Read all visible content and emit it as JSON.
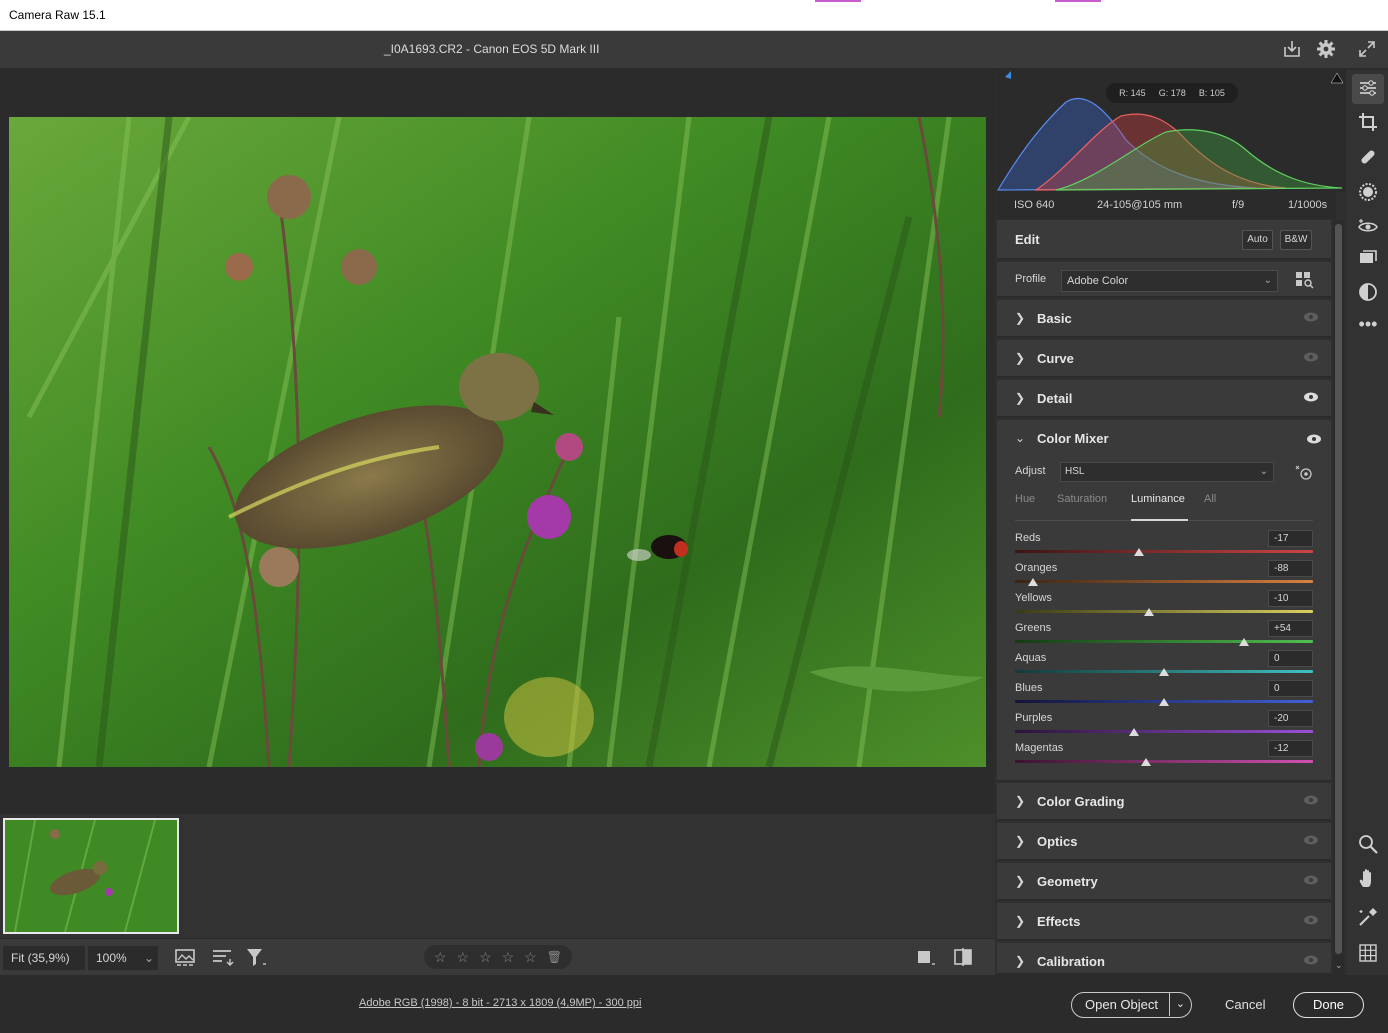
{
  "window": {
    "title": "Camera Raw 15.1"
  },
  "header": {
    "filename": "_I0A1693.CR2  -  Canon EOS 5D Mark III",
    "icons": [
      "save-icon",
      "gear-icon",
      "fullscreen-icon"
    ]
  },
  "histogram": {
    "readout": {
      "r": "R: 145",
      "g": "G: 178",
      "b": "B: 105"
    },
    "colors": {
      "red": "#e04040",
      "green": "#40b040",
      "blue": "#3a6ee0"
    }
  },
  "exif": {
    "iso": "ISO 640",
    "lens": "24-105@105 mm",
    "aperture": "f/9",
    "shutter": "1/1000s"
  },
  "edit": {
    "title": "Edit",
    "auto_label": "Auto",
    "bw_label": "B&W",
    "profile_label": "Profile",
    "profile_value": "Adobe Color"
  },
  "sections_top": [
    {
      "title": "Basic",
      "eye": "dim"
    },
    {
      "title": "Curve",
      "eye": "dim"
    },
    {
      "title": "Detail",
      "eye": "bright"
    }
  ],
  "color_mixer": {
    "title": "Color Mixer",
    "adjust_label": "Adjust",
    "adjust_value": "HSL",
    "tabs": [
      "Hue",
      "Saturation",
      "Luminance",
      "All"
    ],
    "active_tab": "Luminance",
    "sliders": [
      {
        "label": "Reds",
        "value": "-17",
        "num": -17
      },
      {
        "label": "Oranges",
        "value": "-88",
        "num": -88
      },
      {
        "label": "Yellows",
        "value": "-10",
        "num": -10
      },
      {
        "label": "Greens",
        "value": "+54",
        "num": 54
      },
      {
        "label": "Aquas",
        "value": "0",
        "num": 0
      },
      {
        "label": "Blues",
        "value": "0",
        "num": 0
      },
      {
        "label": "Purples",
        "value": "-20",
        "num": -20
      },
      {
        "label": "Magentas",
        "value": "-12",
        "num": -12
      }
    ]
  },
  "sections_bottom": [
    {
      "title": "Color Grading"
    },
    {
      "title": "Optics"
    },
    {
      "title": "Geometry"
    },
    {
      "title": "Effects"
    },
    {
      "title": "Calibration"
    }
  ],
  "bottom_toolbar": {
    "zoom_fit": "Fit (35,9%)",
    "zoom_pct": "100%",
    "rating_stars": 5
  },
  "footer": {
    "workflow": "Adobe RGB (1998) - 8 bit - 2713 x 1809 (4,9MP) - 300 ppi",
    "open_object": "Open Object",
    "cancel": "Cancel",
    "done": "Done"
  },
  "tool_rail": [
    "edit-sliders-icon",
    "crop-icon",
    "healing-brush-icon",
    "masking-icon",
    "red-eye-icon",
    "presets-icon",
    "snapshots-icon",
    "more-icon",
    "zoom-icon",
    "hand-icon",
    "color-sampler-icon",
    "grid-overlay-icon"
  ]
}
